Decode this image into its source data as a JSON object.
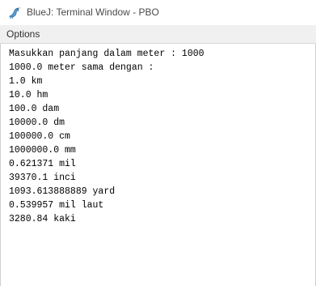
{
  "window": {
    "title": "BlueJ: Terminal Window - PBO",
    "icon": "bluej-bird-icon"
  },
  "menu": {
    "options_label": "Options"
  },
  "terminal": {
    "lines": [
      "Masukkan panjang dalam meter : 1000",
      "1000.0 meter sama dengan :",
      "1.0 km",
      "10.0 hm",
      "100.0 dam",
      "10000.0 dm",
      "100000.0 cm",
      "1000000.0 mm",
      "0.621371 mil",
      "39370.1 inci",
      "1093.613888889 yard",
      "0.539957 mil laut",
      "3280.84 kaki"
    ]
  },
  "colors": {
    "title_text": "#4a4a4a",
    "menubar_bg": "#f0f0f0",
    "terminal_bg": "#ffffff",
    "terminal_text": "#000000",
    "icon_accent": "#5aa0d8"
  }
}
